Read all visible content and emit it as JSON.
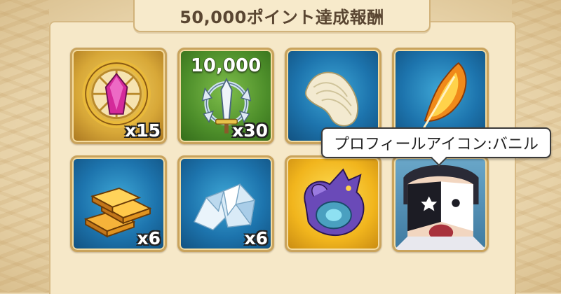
{
  "header": {
    "title": "50,000ポイント達成報酬"
  },
  "rewards": [
    {
      "name": "Pink gem medallion",
      "icon": "gem-medallion-icon",
      "quantity": "x15",
      "background": "gold"
    },
    {
      "name": "Sword emblem",
      "icon": "sword-emblem-icon",
      "amount": "10,000",
      "quantity": "x30",
      "background": "green"
    },
    {
      "name": "Silk bundle",
      "icon": "silk-bundle-icon",
      "quantity": "",
      "background": "blue"
    },
    {
      "name": "Flame feather",
      "icon": "flame-feather-icon",
      "quantity": "",
      "background": "blue"
    },
    {
      "name": "Gold bars",
      "icon": "gold-bars-icon",
      "quantity": "x6",
      "background": "blue"
    },
    {
      "name": "Crystal ore",
      "icon": "crystal-ore-icon",
      "quantity": "x6",
      "background": "blue"
    },
    {
      "name": "Purple dragon",
      "icon": "dragon-icon",
      "quantity": "",
      "background": "yellow"
    },
    {
      "name": "Profile icon Vanir",
      "icon": "character-portrait-icon",
      "quantity": "",
      "background": "portrait"
    }
  ],
  "tooltip": {
    "text": "プロフィールアイコン:バニル"
  }
}
